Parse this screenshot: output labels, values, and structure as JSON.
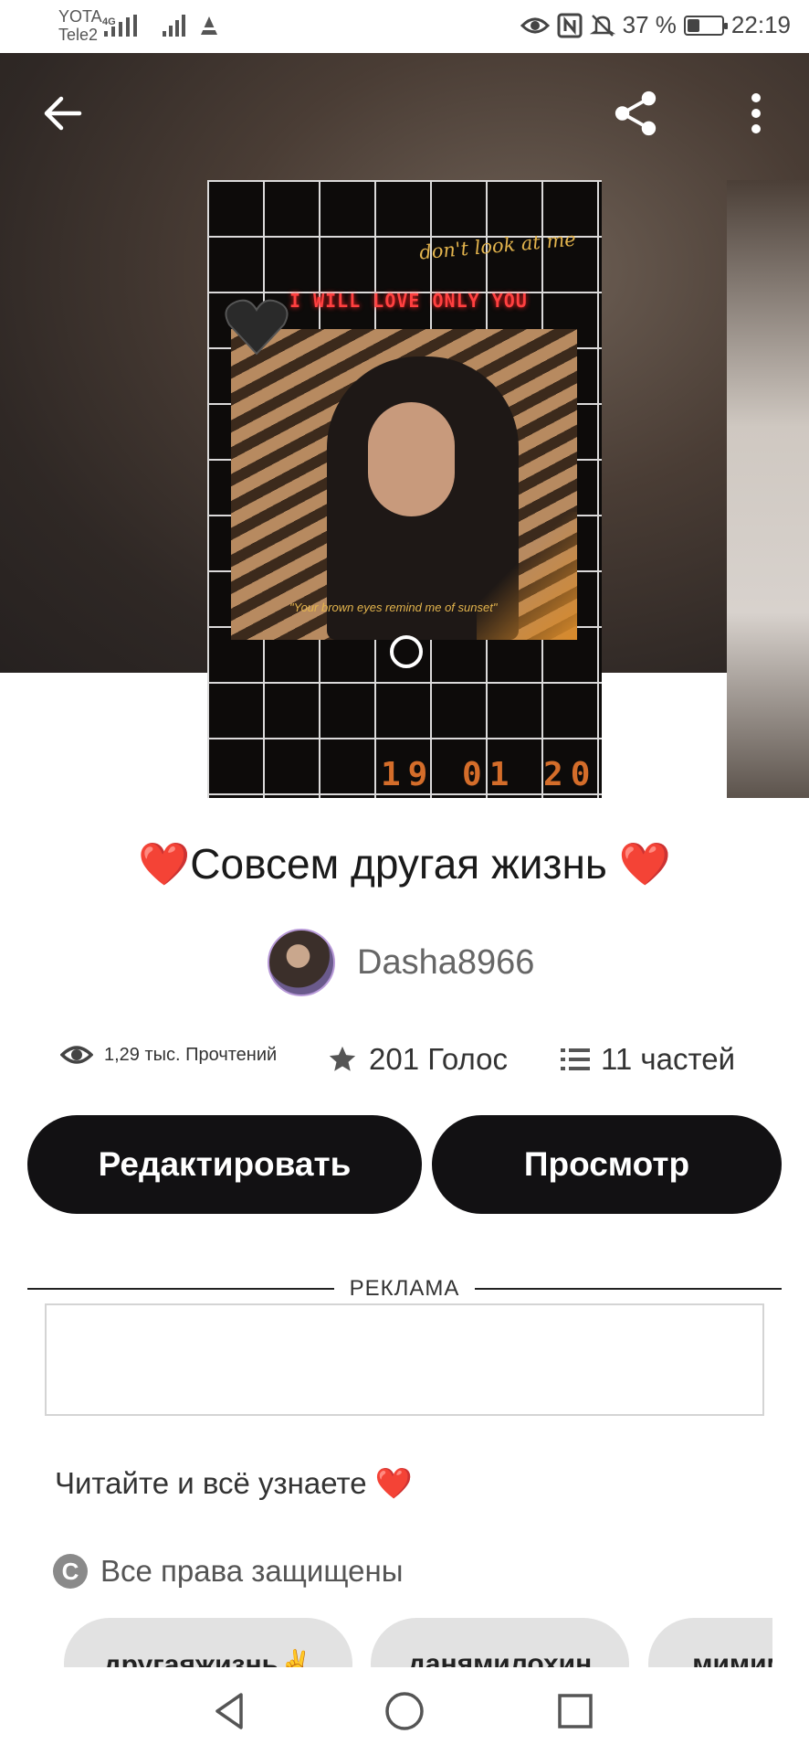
{
  "status_bar": {
    "carrier1": "YOTA",
    "carrier2": "Tele2",
    "network": "4G",
    "battery_text": "37 %",
    "battery_level": 0.37,
    "time": "22:19",
    "icons": [
      "signal-icon",
      "signal-icon",
      "notification-icon",
      "eye-icon",
      "nfc-icon",
      "mute-icon",
      "battery-icon"
    ]
  },
  "toolbar": {
    "back_icon": "arrow-left-icon",
    "share_icon": "share-icon",
    "more_icon": "more-vertical-icon"
  },
  "cover": {
    "text_top": "don't look at me",
    "text_neon": "I WILL LOVE ONLY YOU",
    "text_quote": "\"Your brown eyes remind me of sunset\"",
    "text_digits": "19 01 20"
  },
  "story": {
    "title": "❤️Совсем другая жизнь ❤️",
    "author": "Dasha8966",
    "reads": "1,29 тыс. Прочтений",
    "votes": "201 Голос",
    "parts": "11 частей",
    "description": "Читайте и всё узнаете ❤️",
    "copyright": "Все права защищены",
    "copyright_symbol": "C"
  },
  "actions": {
    "edit_label": "Редактировать",
    "view_label": "Просмотр"
  },
  "ad": {
    "label": "РЕКЛАМА"
  },
  "tags": [
    "другаяжизнь✌️",
    "данямилохин",
    "мимим"
  ],
  "nav": {
    "back_icon": "triangle-back-icon",
    "home_icon": "circle-home-icon",
    "recents_icon": "square-recents-icon"
  }
}
